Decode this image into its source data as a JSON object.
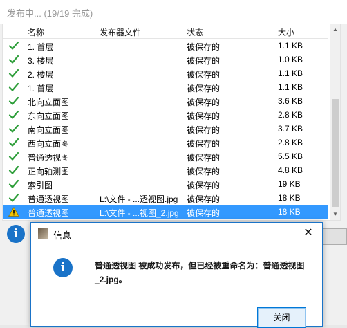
{
  "window": {
    "title": "发布中... (19/19 完成)"
  },
  "columns": {
    "name": "名称",
    "file": "发布器文件",
    "status": "状态",
    "size": "大小"
  },
  "rows": [
    {
      "name": "1. 首层",
      "file": "",
      "status": "被保存的",
      "size": "1.1 KB",
      "icon": "check-icon"
    },
    {
      "name": "3. 楼层",
      "file": "",
      "status": "被保存的",
      "size": "1.0 KB",
      "icon": "check-icon"
    },
    {
      "name": "2. 楼层",
      "file": "",
      "status": "被保存的",
      "size": "1.1 KB",
      "icon": "check-icon"
    },
    {
      "name": "1. 首层",
      "file": "",
      "status": "被保存的",
      "size": "1.1 KB",
      "icon": "check-icon"
    },
    {
      "name": "北向立面图",
      "file": "",
      "status": "被保存的",
      "size": "3.6 KB",
      "icon": "check-icon"
    },
    {
      "name": "东向立面图",
      "file": "",
      "status": "被保存的",
      "size": "2.8 KB",
      "icon": "check-icon"
    },
    {
      "name": "南向立面图",
      "file": "",
      "status": "被保存的",
      "size": "3.7 KB",
      "icon": "check-icon"
    },
    {
      "name": "西向立面图",
      "file": "",
      "status": "被保存的",
      "size": "2.8 KB",
      "icon": "check-icon"
    },
    {
      "name": "普通透视图",
      "file": "",
      "status": "被保存的",
      "size": "5.5 KB",
      "icon": "check-icon"
    },
    {
      "name": "正向轴测图",
      "file": "",
      "status": "被保存的",
      "size": "4.8 KB",
      "icon": "check-icon"
    },
    {
      "name": "索引图",
      "file": "",
      "status": "被保存的",
      "size": "19 KB",
      "icon": "check-icon"
    },
    {
      "name": "普通透视图",
      "file": "L:\\文件 - ...透视图.jpg",
      "status": "被保存的",
      "size": "18 KB",
      "icon": "check-icon"
    },
    {
      "name": "普通透视图",
      "file": "L:\\文件 - ...视图_2.jpg",
      "status": "被保存的",
      "size": "18 KB",
      "icon": "warning-icon",
      "selected": true
    }
  ],
  "colors": {
    "check": "#2e9e3a",
    "warning": "#f2c200",
    "selection": "#3399ff",
    "info": "#1a73c8"
  },
  "dialog": {
    "title": "信息",
    "message": "普通透视图 被成功发布，但已经被重命名为：普通透视图_2.jpg。",
    "close_label": "关闭",
    "close_glyph": "✕"
  },
  "info_glyph": "i"
}
